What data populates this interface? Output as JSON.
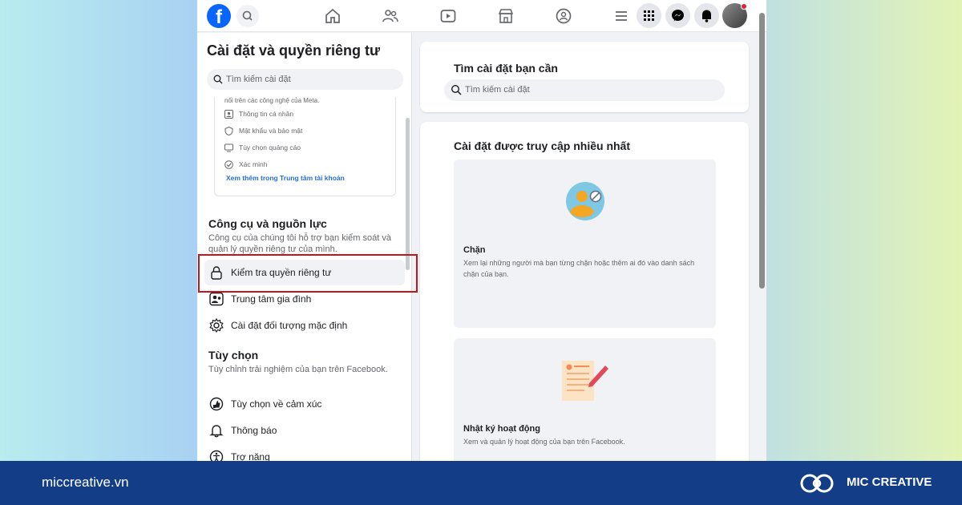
{
  "sidebar": {
    "title": "Cài đặt và quyền riêng tư",
    "search_placeholder": "Tìm kiếm cài đặt",
    "accounts_card": {
      "description": "nối trên các công nghệ của Meta.",
      "items": [
        {
          "label": "Thông tin cá nhân",
          "icon": "id-card-icon"
        },
        {
          "label": "Mật khẩu và bảo mật",
          "icon": "shield-icon"
        },
        {
          "label": "Tùy chọn quảng cáo",
          "icon": "monitor-icon"
        },
        {
          "label": "Xác minh",
          "icon": "check-circle-icon"
        }
      ],
      "link": "Xem thêm trong Trung tâm tài khoản"
    },
    "tools": {
      "title": "Công cụ và nguồn lực",
      "description": "Công cụ của chúng tôi hỗ trợ bạn kiểm soát và quản lý quyền riêng tư của mình.",
      "items": [
        {
          "label": "Kiểm tra quyền riêng tư",
          "icon": "lock-icon"
        },
        {
          "label": "Trung tâm gia đình",
          "icon": "family-icon"
        },
        {
          "label": "Cài đặt đối tượng mặc định",
          "icon": "gear-icon"
        }
      ]
    },
    "preferences": {
      "title": "Tùy chọn",
      "description": "Tùy chỉnh trải nghiệm của bạn trên Facebook.",
      "items": [
        {
          "label": "Tùy chọn về cảm xúc",
          "icon": "reaction-icon"
        },
        {
          "label": "Thông báo",
          "icon": "bell-icon"
        },
        {
          "label": "Trợ năng",
          "icon": "accessibility-icon"
        }
      ]
    }
  },
  "main": {
    "find": {
      "title": "Tìm cài đặt bạn cần",
      "search_placeholder": "Tìm kiếm cài đặt"
    },
    "most_used": {
      "title": "Cài đặt được truy cập nhiều nhất",
      "tiles": [
        {
          "title": "Chặn",
          "description": "Xem lại những người mà bạn từng chặn hoặc thêm ai đó vào danh sách chặn của bạn.",
          "icon": "blocked-user-icon"
        },
        {
          "title": "Nhật ký hoạt động",
          "description": "Xem và quản lý hoạt động của bạn trên Facebook.",
          "icon": "activity-log-icon"
        }
      ]
    }
  },
  "footer": {
    "site": "miccreative.vn",
    "brand": "MIC CREATIVE"
  },
  "colors": {
    "facebook_blue": "#0866ff",
    "highlight_red": "#c0161c",
    "footer_blue": "#133e87"
  }
}
